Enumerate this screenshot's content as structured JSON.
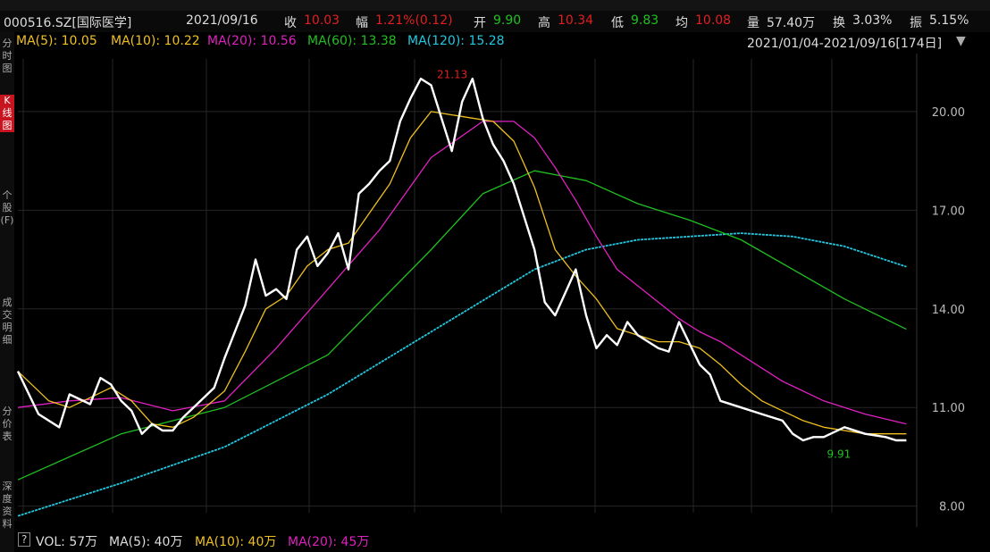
{
  "quote": {
    "code": "000516.SZ[国际医学]",
    "date": "2021/09/16",
    "close_label": "收",
    "close": "10.03",
    "change_label": "幅",
    "change": "1.21%(0.12)",
    "open_label": "开",
    "open": "9.90",
    "high_label": "高",
    "high": "10.34",
    "low_label": "低",
    "low": "9.83",
    "avg_label": "均",
    "avg": "10.08",
    "volume_label": "量",
    "volume": "57.40万",
    "turnover_label": "换",
    "turnover": "3.03%",
    "amplitude_label": "振",
    "amplitude": "5.15%"
  },
  "ma_legend": [
    {
      "label": "MA(5): 10.05",
      "color": "#ffffff"
    },
    {
      "label": "MA(10): 10.22",
      "color": "#f0c020"
    },
    {
      "label": "MA(20): 10.56",
      "color": "#e020c0"
    },
    {
      "label": "MA(60): 13.38",
      "color": "#20c020"
    },
    {
      "label": "MA(120): 15.28",
      "color": "#20c8e0"
    }
  ],
  "range_label": "2021/01/04-2021/09/16[174日]",
  "left_rail": [
    "分时图",
    "K线图",
    "个股(F)",
    "成交明细",
    "分价表",
    "深度资料"
  ],
  "volume_legend": {
    "help": "?",
    "vol": "VOL: 57万",
    "ma5": "MA(5): 40万",
    "ma10": "MA(10): 40万",
    "ma20": "MA(20): 45万"
  },
  "colors": {
    "up": "#e02020",
    "down": "#20c020",
    "ma5": "#ffffff",
    "ma10": "#f0c020",
    "ma20": "#e020c0",
    "ma60": "#20c020",
    "ma120": "#20c8e0"
  },
  "chart_data": {
    "type": "line",
    "y_ticks": [
      "20.00",
      "17.00",
      "14.00",
      "11.00",
      "8.00"
    ],
    "y_range": [
      7.8,
      21.6
    ],
    "annotations": [
      {
        "label": "21.13",
        "x": 78,
        "y": 21.13,
        "color": "#e02020"
      },
      {
        "label": "9.91",
        "x": 167,
        "y": 9.91,
        "color": "#20c020"
      }
    ],
    "series": [
      {
        "name": "MA(5)",
        "x": [
          0,
          4,
          8,
          10,
          14,
          16,
          18,
          20,
          22,
          24,
          26,
          28,
          30,
          32,
          34,
          38,
          40,
          44,
          46,
          48,
          50,
          52,
          54,
          56,
          58,
          60,
          62,
          64,
          66,
          68,
          70,
          72,
          74,
          76,
          78,
          80,
          82,
          84,
          86,
          88,
          90,
          92,
          94,
          96,
          98,
          100,
          102,
          104,
          106,
          108,
          110,
          112,
          114,
          116,
          118,
          120,
          124,
          126,
          128,
          132,
          134,
          136,
          140,
          144,
          148,
          150,
          152,
          154,
          156,
          160,
          164,
          168,
          170,
          172
        ],
        "values": [
          12.1,
          10.8,
          10.4,
          11.4,
          11.1,
          11.9,
          11.7,
          11.2,
          10.9,
          10.2,
          10.5,
          10.3,
          10.3,
          10.7,
          11.0,
          11.6,
          12.5,
          14.1,
          15.5,
          14.4,
          14.6,
          14.3,
          15.8,
          16.2,
          15.3,
          15.7,
          16.3,
          15.2,
          17.5,
          17.8,
          18.2,
          18.5,
          19.7,
          20.4,
          21.0,
          20.8,
          19.8,
          18.8,
          20.3,
          21.0,
          19.8,
          19.0,
          18.5,
          17.8,
          16.8,
          15.8,
          14.2,
          13.8,
          14.5,
          15.2,
          13.8,
          12.8,
          13.2,
          12.9,
          13.6,
          13.2,
          12.8,
          12.7,
          13.6,
          12.3,
          12.0,
          11.2,
          11.0,
          10.8,
          10.6,
          10.2,
          10.0,
          10.1,
          10.1,
          10.4,
          10.2,
          10.1,
          10.0,
          10.0
        ]
      },
      {
        "name": "MA(10)",
        "x": [
          0,
          6,
          10,
          14,
          18,
          22,
          26,
          30,
          34,
          40,
          44,
          48,
          52,
          56,
          60,
          64,
          68,
          72,
          76,
          80,
          84,
          88,
          92,
          96,
          100,
          104,
          108,
          112,
          116,
          120,
          124,
          128,
          132,
          136,
          140,
          144,
          148,
          152,
          156,
          160,
          164,
          168,
          172
        ],
        "values": [
          12.1,
          11.2,
          11.0,
          11.3,
          11.6,
          11.2,
          10.5,
          10.4,
          10.7,
          11.5,
          12.7,
          14.0,
          14.4,
          15.3,
          15.8,
          16.0,
          16.9,
          17.8,
          19.2,
          20.0,
          19.9,
          19.8,
          19.7,
          19.1,
          17.7,
          15.8,
          15.0,
          14.3,
          13.4,
          13.2,
          13.0,
          13.0,
          12.8,
          12.3,
          11.7,
          11.2,
          10.9,
          10.6,
          10.4,
          10.3,
          10.2,
          10.2,
          10.2
        ]
      },
      {
        "name": "MA(20)",
        "x": [
          0,
          10,
          20,
          30,
          40,
          50,
          60,
          70,
          80,
          90,
          96,
          100,
          104,
          108,
          112,
          116,
          120,
          124,
          128,
          132,
          136,
          140,
          148,
          156,
          164,
          172
        ],
        "values": [
          11.0,
          11.2,
          11.3,
          10.9,
          11.2,
          12.8,
          14.6,
          16.4,
          18.6,
          19.7,
          19.7,
          19.2,
          18.3,
          17.3,
          16.2,
          15.2,
          14.7,
          14.2,
          13.7,
          13.3,
          13.0,
          12.6,
          11.8,
          11.2,
          10.8,
          10.5
        ]
      },
      {
        "name": "MA(60)",
        "x": [
          0,
          20,
          40,
          60,
          80,
          90,
          100,
          110,
          120,
          130,
          140,
          150,
          160,
          172
        ],
        "values": [
          8.8,
          10.2,
          11.0,
          12.6,
          15.8,
          17.5,
          18.2,
          17.9,
          17.2,
          16.7,
          16.1,
          15.2,
          14.3,
          13.38
        ]
      },
      {
        "name": "MA(120)",
        "x": [
          0,
          20,
          40,
          60,
          80,
          100,
          110,
          120,
          130,
          140,
          150,
          160,
          172
        ],
        "values": [
          7.7,
          8.7,
          9.8,
          11.4,
          13.3,
          15.2,
          15.8,
          16.1,
          16.2,
          16.3,
          16.2,
          15.9,
          15.28
        ]
      }
    ]
  }
}
